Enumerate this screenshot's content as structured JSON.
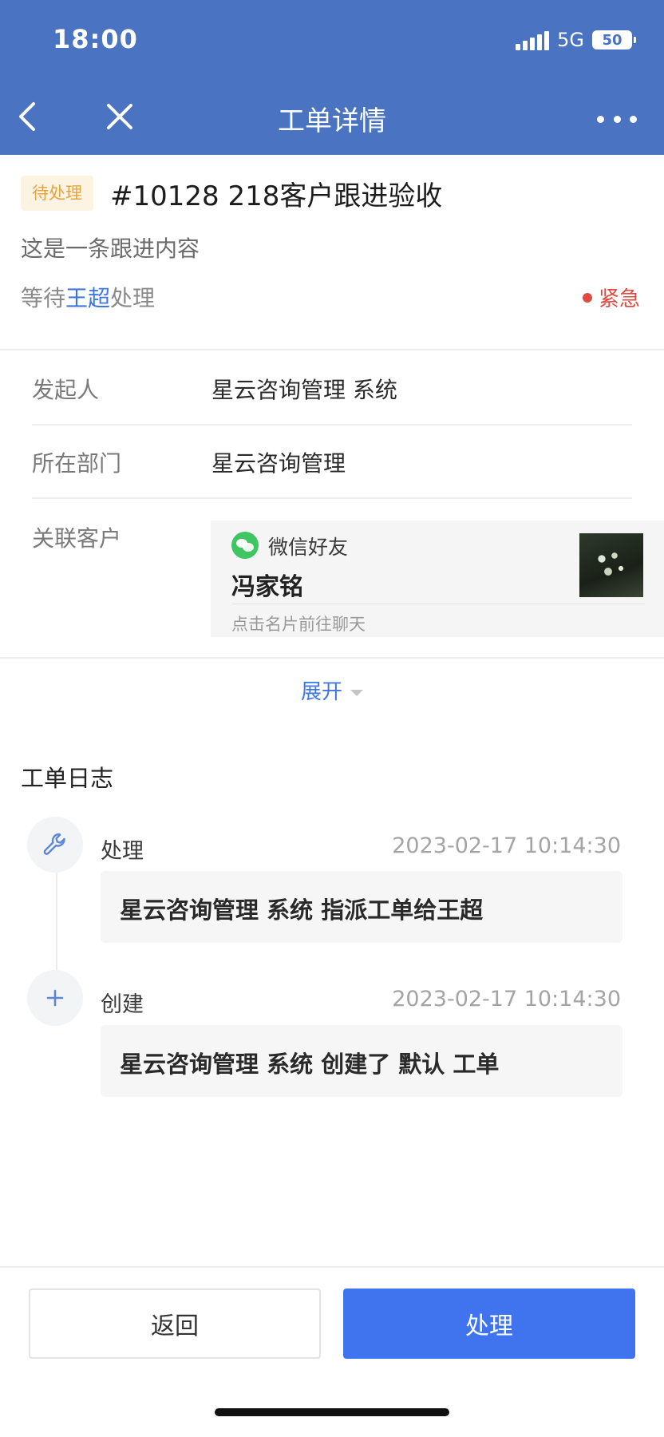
{
  "status_bar": {
    "time": "18:00",
    "network": "5G",
    "battery": "50"
  },
  "nav": {
    "title": "工单详情"
  },
  "ticket": {
    "status_badge": "待处理",
    "title": "#10128  218客户跟进验收",
    "description": "这是一条跟进内容",
    "wait_prefix": "等待",
    "assignee": "王超",
    "wait_suffix": "处理",
    "priority": "紧急"
  },
  "info": {
    "initiator_label": "发起人",
    "initiator_value": "星云咨询管理 系统",
    "department_label": "所在部门",
    "department_value": "星云咨询管理",
    "customer_label": "关联客户"
  },
  "contact_card": {
    "source": "微信好友",
    "name": "冯家铭",
    "hint": "点击名片前往聊天"
  },
  "expand": {
    "label": "展开"
  },
  "log": {
    "title": "工单日志",
    "entries": [
      {
        "type": "处理",
        "time": "2023-02-17 10:14:30",
        "text": "星云咨询管理 系统 指派工单给王超",
        "icon": "wrench-icon"
      },
      {
        "type": "创建",
        "time": "2023-02-17 10:14:30",
        "text": "星云咨询管理 系统 创建了 默认 工单",
        "icon": "plus-icon"
      }
    ]
  },
  "actions": {
    "back": "返回",
    "process": "处理"
  },
  "colors": {
    "header_bg": "#4a73c1",
    "primary": "#3f74ee",
    "link": "#3f77e0",
    "urgent": "#e04b41",
    "pending_badge": "#e4a440",
    "wechat": "#3fc561"
  }
}
